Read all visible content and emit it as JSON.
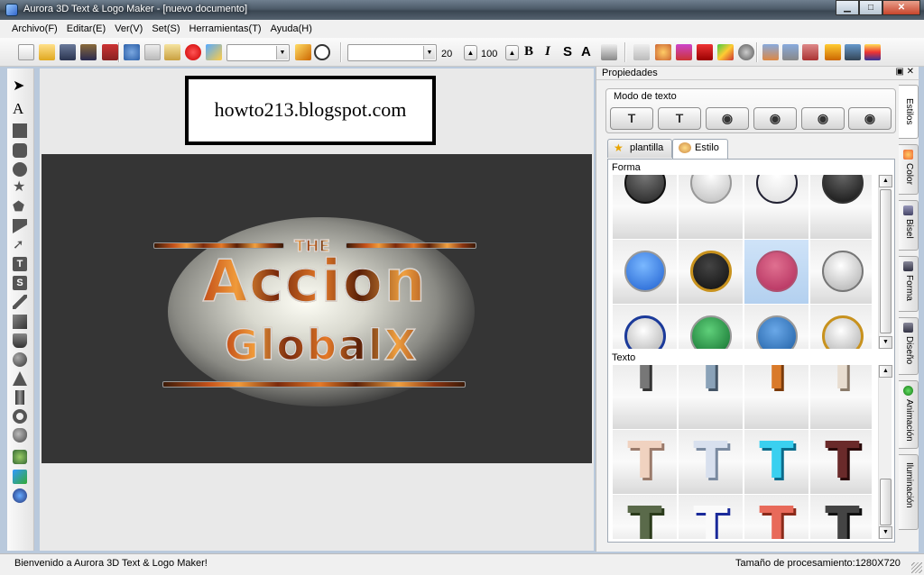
{
  "window": {
    "title": "Aurora 3D Text & Logo Maker - [nuevo documento]"
  },
  "menu": [
    "Archivo(F)",
    "Editar(E)",
    "Ver(V)",
    "Set(S)",
    "Herramientas(T)",
    "Ayuda(H)"
  ],
  "toolbar": {
    "font_size": "20",
    "zoom": "100",
    "bold": "B",
    "italic": "I",
    "strike": "S",
    "shadow": "A"
  },
  "watermark": "howto213.blogspot.com",
  "logo": {
    "top": "THE",
    "main": "Accion",
    "sub": "GlobalX"
  },
  "panel": {
    "title": "Propiedades",
    "controls": "▣ ✕",
    "modo_label": "Modo de texto",
    "tabs": [
      {
        "label": "plantilla"
      },
      {
        "label": "Estilo"
      }
    ],
    "shape_label": "Forma",
    "text_label": "Texto",
    "side_tabs": [
      "Estilos",
      "Color",
      "Bisel",
      "Forma",
      "Diseño",
      "Animación",
      "Iluminación"
    ]
  },
  "status": {
    "left": "Bienvenido a Aurora 3D Text & Logo Maker!",
    "right": "Tamaño de procesamiento:1280X720"
  }
}
